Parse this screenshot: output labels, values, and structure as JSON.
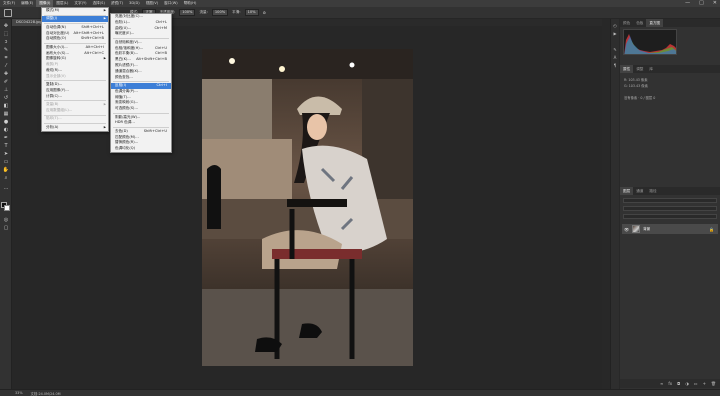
{
  "menubar": {
    "items": [
      "文件(F)",
      "编辑(E)",
      "图像(I)",
      "图层(L)",
      "文字(Y)",
      "选择(S)",
      "滤镜(T)",
      "3D(D)",
      "视图(V)",
      "窗口(W)",
      "帮助(H)"
    ],
    "window_buttons": [
      "—",
      "□",
      "✕"
    ]
  },
  "optbar": {
    "items": [
      "模式:",
      "正常",
      "不透明度:",
      "100%",
      "流量:",
      "100%",
      "平滑:",
      "10%"
    ]
  },
  "document_tab": "DSC04228.jpg @ 33.3% (RGB/8)",
  "image_menu": {
    "items": [
      {
        "label": "模式(M)",
        "shortcut": "",
        "submenu": true
      },
      {
        "sep": true
      },
      {
        "label": "调整(J)",
        "shortcut": "",
        "submenu": true,
        "highlight": true
      },
      {
        "sep": true
      },
      {
        "label": "自动色调(N)",
        "shortcut": "Shift+Ctrl+L"
      },
      {
        "label": "自动对比度(U)",
        "shortcut": "Alt+Shift+Ctrl+L"
      },
      {
        "label": "自动颜色(O)",
        "shortcut": "Shift+Ctrl+B"
      },
      {
        "sep": true
      },
      {
        "label": "图像大小(I)...",
        "shortcut": "Alt+Ctrl+I"
      },
      {
        "label": "画布大小(S)...",
        "shortcut": "Alt+Ctrl+C"
      },
      {
        "label": "图像旋转(G)",
        "shortcut": "",
        "submenu": true
      },
      {
        "label": "裁剪(P)",
        "shortcut": "",
        "disabled": true
      },
      {
        "label": "裁切(R)...",
        "shortcut": ""
      },
      {
        "label": "显示全部(V)",
        "shortcut": "",
        "disabled": true
      },
      {
        "sep": true
      },
      {
        "label": "复制(D)...",
        "shortcut": ""
      },
      {
        "label": "应用图像(Y)...",
        "shortcut": ""
      },
      {
        "label": "计算(C)...",
        "shortcut": ""
      },
      {
        "sep": true
      },
      {
        "label": "变量(B)",
        "shortcut": "",
        "submenu": true,
        "disabled": true
      },
      {
        "label": "应用数据组(L)...",
        "shortcut": "",
        "disabled": true
      },
      {
        "sep": true
      },
      {
        "label": "陷印(T)...",
        "shortcut": "",
        "disabled": true
      },
      {
        "sep": true
      },
      {
        "label": "分析(A)",
        "shortcut": "",
        "submenu": true
      }
    ]
  },
  "adjust_menu": {
    "items": [
      {
        "label": "亮度/对比度(C)...",
        "shortcut": ""
      },
      {
        "label": "色阶(L)...",
        "shortcut": "Ctrl+L"
      },
      {
        "label": "曲线(U)...",
        "shortcut": "Ctrl+M"
      },
      {
        "label": "曝光度(E)...",
        "shortcut": ""
      },
      {
        "sep": true
      },
      {
        "label": "自然饱和度(V)...",
        "shortcut": ""
      },
      {
        "label": "色相/饱和度(H)...",
        "shortcut": "Ctrl+U"
      },
      {
        "label": "色彩平衡(B)...",
        "shortcut": "Ctrl+B"
      },
      {
        "label": "黑白(K)...",
        "shortcut": "Alt+Shift+Ctrl+B"
      },
      {
        "label": "照片滤镜(F)...",
        "shortcut": ""
      },
      {
        "label": "通道混合器(X)...",
        "shortcut": ""
      },
      {
        "label": "颜色查找...",
        "shortcut": ""
      },
      {
        "sep": true
      },
      {
        "label": "反相(I)",
        "shortcut": "Ctrl+I",
        "highlight": true
      },
      {
        "label": "色调分离(P)...",
        "shortcut": ""
      },
      {
        "label": "阈值(T)...",
        "shortcut": ""
      },
      {
        "label": "渐变映射(G)...",
        "shortcut": ""
      },
      {
        "label": "可选颜色(S)...",
        "shortcut": ""
      },
      {
        "sep": true
      },
      {
        "label": "阴影/高光(W)...",
        "shortcut": ""
      },
      {
        "label": "HDR 色调...",
        "shortcut": ""
      },
      {
        "sep": true
      },
      {
        "label": "去色(D)",
        "shortcut": "Shift+Ctrl+U"
      },
      {
        "label": "匹配颜色(M)...",
        "shortcut": ""
      },
      {
        "label": "替换颜色(R)...",
        "shortcut": ""
      },
      {
        "label": "色调均化(Q)",
        "shortcut": ""
      }
    ]
  },
  "panels": {
    "top_tabs": [
      "颜色",
      "色板",
      "直方图"
    ],
    "mid_tabs": [
      "属性",
      "调整",
      "库"
    ],
    "props": [
      "R: 103.43  像素",
      "G: 103.43  像素",
      "没有像素 · 0 / 图层 0"
    ],
    "layer_tabs": [
      "图层",
      "通道",
      "路径"
    ],
    "layer_name": "背景",
    "layer_lock": "🔒"
  },
  "status": {
    "zoom": "33%",
    "doc_info": "文档:24.0M/24.0M"
  },
  "colors": {
    "highlight": "#3d7fd7",
    "menu_bg": "#f2f2f2"
  }
}
